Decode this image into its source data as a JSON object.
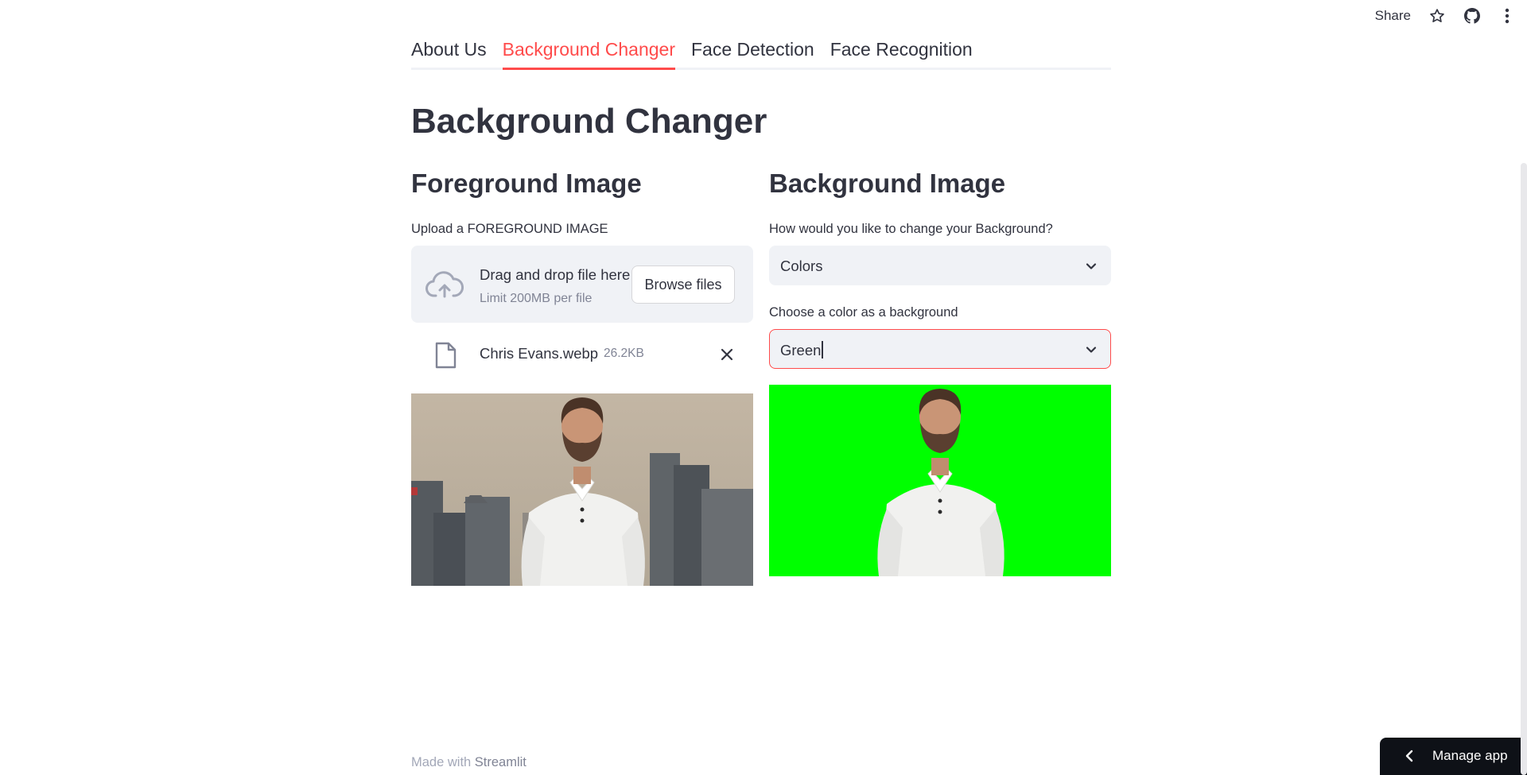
{
  "toolbar": {
    "share_label": "Share",
    "icons": [
      "star-icon",
      "github-icon",
      "more-vertical-icon"
    ]
  },
  "tabs": [
    {
      "label": "About Us",
      "active": false
    },
    {
      "label": "Background Changer",
      "active": true
    },
    {
      "label": "Face Detection",
      "active": false
    },
    {
      "label": "Face Recognition",
      "active": false
    }
  ],
  "page": {
    "title": "Background Changer"
  },
  "foreground": {
    "title": "Foreground Image",
    "upload_label": "Upload a FOREGROUND IMAGE",
    "dropzone_title": "Drag and drop file here",
    "dropzone_limit": "Limit 200MB per file",
    "browse_label": "Browse files",
    "file": {
      "name": "Chris Evans.webp",
      "size": "26.2KB"
    }
  },
  "background": {
    "title": "Background Image",
    "method_label": "How would you like to change your Background?",
    "method_value": "Colors",
    "color_label": "Choose a color as a background",
    "color_value": "Green",
    "preview_color": "#00ff00"
  },
  "footer": {
    "made_with": "Made with",
    "brand": "Streamlit"
  },
  "manage_app": {
    "label": "Manage app"
  },
  "colors": {
    "accent": "#ff4b4b",
    "text": "#31333f",
    "muted": "#808495",
    "input_bg": "#f0f2f6",
    "dark": "#0e1117"
  }
}
